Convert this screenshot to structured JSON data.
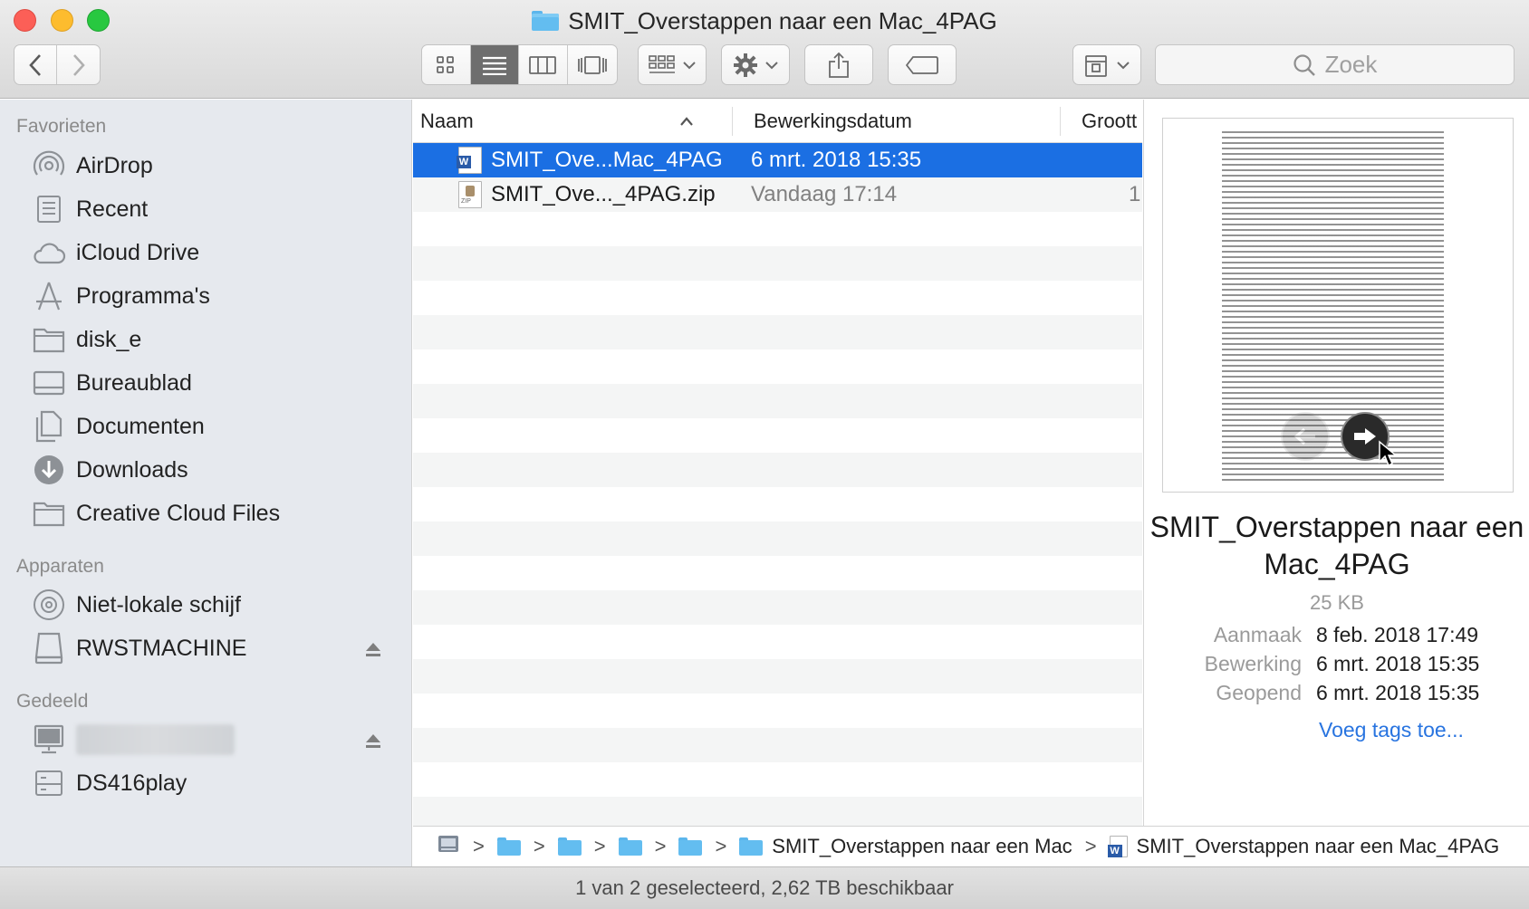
{
  "window": {
    "title": "SMIT_Overstappen naar een Mac_4PAG"
  },
  "toolbar": {
    "search_placeholder": "Zoek",
    "view_modes": [
      "icon",
      "list",
      "columns",
      "cover-flow"
    ],
    "active_view": "list"
  },
  "sidebar": {
    "sections": [
      {
        "heading": "Favorieten",
        "items": [
          {
            "label": "AirDrop",
            "icon": "airdrop-icon"
          },
          {
            "label": "Recent",
            "icon": "recent-icon"
          },
          {
            "label": "iCloud Drive",
            "icon": "cloud-icon"
          },
          {
            "label": "Programma's",
            "icon": "applications-icon"
          },
          {
            "label": "disk_e",
            "icon": "folder-icon"
          },
          {
            "label": "Bureaublad",
            "icon": "desktop-icon"
          },
          {
            "label": "Documenten",
            "icon": "documents-icon"
          },
          {
            "label": "Downloads",
            "icon": "downloads-icon"
          },
          {
            "label": "Creative Cloud Files",
            "icon": "folder-icon"
          }
        ]
      },
      {
        "heading": "Apparaten",
        "items": [
          {
            "label": "Niet-lokale schijf",
            "icon": "disc-icon"
          },
          {
            "label": "RWSTMACHINE",
            "icon": "drive-icon",
            "eject": true
          }
        ]
      },
      {
        "heading": "Gedeeld",
        "items": [
          {
            "label": "",
            "icon": "computer-icon",
            "eject": true,
            "redacted": true
          },
          {
            "label": "DS416play",
            "icon": "server-icon"
          }
        ]
      }
    ]
  },
  "list": {
    "columns": {
      "name": "Naam",
      "date": "Bewerkingsdatum",
      "size": "Groott"
    },
    "sort_indicator": "^",
    "rows": [
      {
        "name": "SMIT_Ove...Mac_4PAG",
        "date": "6 mrt. 2018 15:35",
        "size": "",
        "kind": "word",
        "selected": true
      },
      {
        "name": "SMIT_Ove..._4PAG.zip",
        "date": "Vandaag 17:14",
        "size": "1",
        "kind": "zip",
        "selected": false
      }
    ]
  },
  "pathbar": {
    "segments": [
      "",
      "",
      "",
      "",
      "",
      "SMIT_Overstappen naar een Mac",
      "SMIT_Overstappen naar een Mac_4PAG"
    ],
    "separator": ">"
  },
  "preview": {
    "title": "SMIT_Overstappen naar een Mac_4PAG",
    "size": "25 KB",
    "meta": [
      {
        "label": "Aanmaak",
        "value": "8 feb. 2018 17:49"
      },
      {
        "label": "Bewerking",
        "value": "6 mrt. 2018 15:35"
      },
      {
        "label": "Geopend",
        "value": "6 mrt. 2018 15:35"
      }
    ],
    "tags_link": "Voeg tags toe..."
  },
  "status": {
    "text": "1 van 2 geselecteerd, 2,62 TB beschikbaar"
  },
  "colors": {
    "selection": "#1b6fe3",
    "sidebar_bg": "#e6e9ee",
    "link": "#2874e0",
    "folder": "#63bdf0"
  }
}
